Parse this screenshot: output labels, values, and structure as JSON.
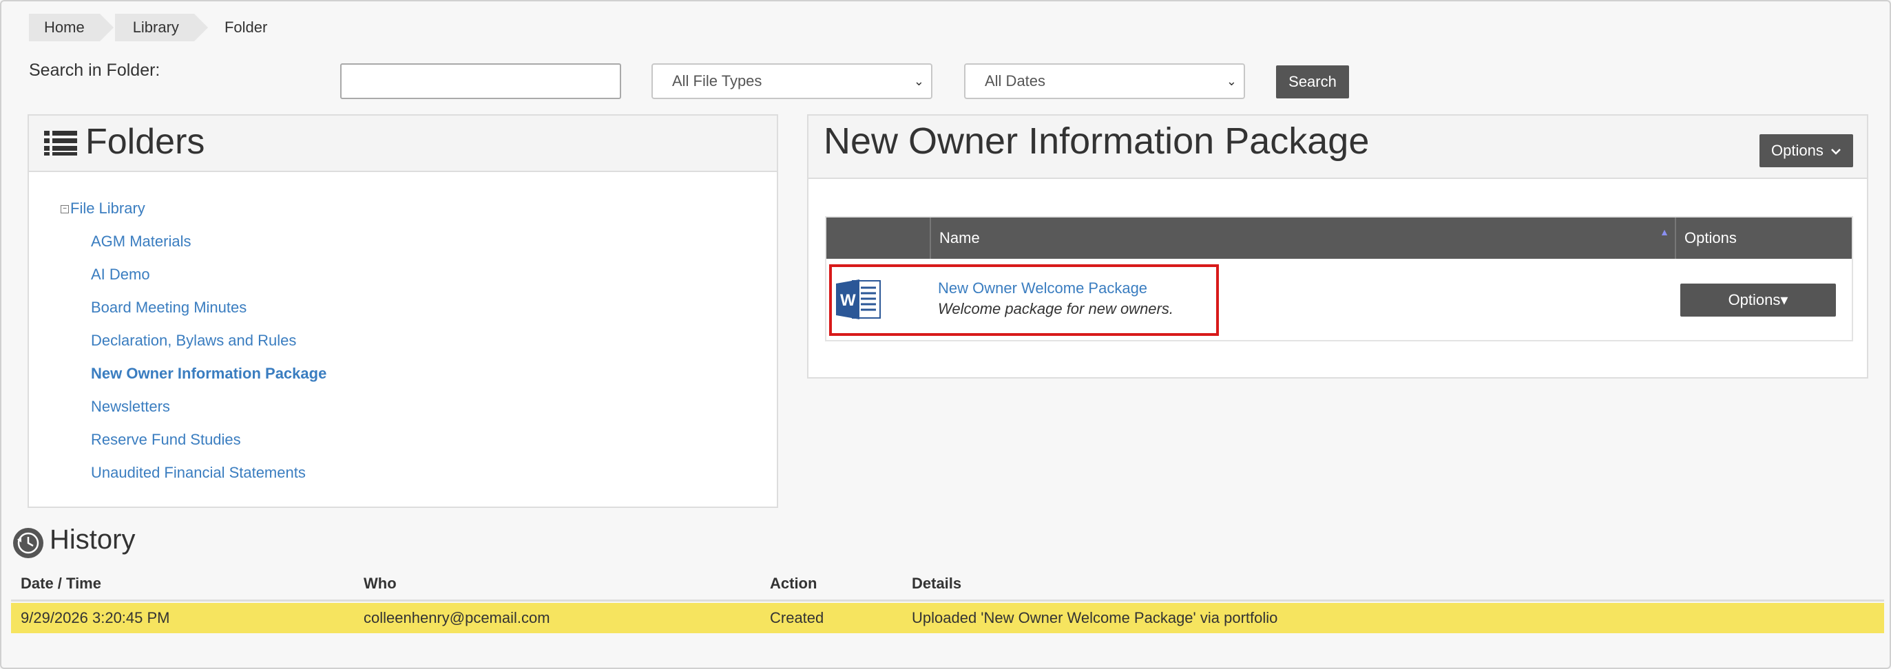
{
  "breadcrumb": {
    "home": "Home",
    "library": "Library",
    "current": "Folder"
  },
  "search": {
    "label": "Search in Folder:",
    "input_value": "",
    "file_types_selected": "All File Types",
    "dates_selected": "All Dates",
    "button_label": "Search"
  },
  "folders_panel": {
    "title": "Folders",
    "root": "File Library",
    "items": [
      {
        "label": "AGM Materials",
        "active": false
      },
      {
        "label": "AI Demo",
        "active": false
      },
      {
        "label": "Board Meeting Minutes",
        "active": false
      },
      {
        "label": "Declaration, Bylaws and Rules",
        "active": false
      },
      {
        "label": "New Owner Information Package",
        "active": true
      },
      {
        "label": "Newsletters",
        "active": false
      },
      {
        "label": "Reserve Fund Studies",
        "active": false
      },
      {
        "label": "Unaudited Financial Statements",
        "active": false
      }
    ]
  },
  "package_panel": {
    "title": "New Owner Information Package",
    "options_label": "Options",
    "table": {
      "col_name": "Name",
      "col_options": "Options",
      "rows": [
        {
          "name": "New Owner Welcome Package",
          "description": "Welcome package for new owners.",
          "options_label": "Options▾",
          "icon": "word-document-icon"
        }
      ]
    }
  },
  "history": {
    "title": "History",
    "columns": [
      "Date / Time",
      "Who",
      "Action",
      "Details"
    ],
    "rows": [
      {
        "datetime": "9/29/2026 3:20:45 PM",
        "who": "colleenhenry@pcemail.com",
        "action": "Created",
        "details": "Uploaded 'New Owner Welcome Package' via portfolio"
      }
    ]
  },
  "colors": {
    "link": "#3a7dc0",
    "button": "#555555",
    "highlight_row": "#f6e45f",
    "selection_box": "#d81a1a",
    "word_blue": "#2b5797"
  }
}
